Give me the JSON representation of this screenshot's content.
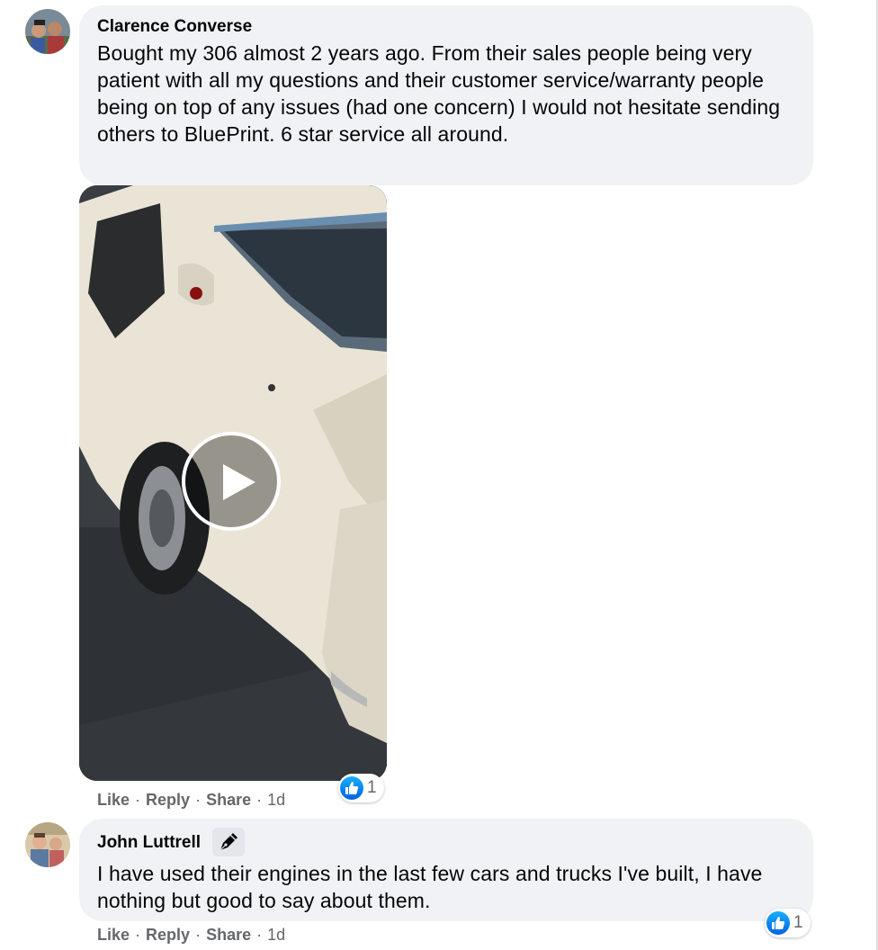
{
  "colors": {
    "bubble_bg": "#f0f2f5",
    "action_text": "#65676b",
    "like_blue": "#1877f2",
    "text": "#050505"
  },
  "comments": [
    {
      "author": "Clarence Converse",
      "text": "Bought my 306 almost 2 years ago. From their sales people being very patient with all my questions and their customer service/warranty people being on top of any issues (had one concern) I would not hesitate sending others to BluePrint. 6 star service all around.",
      "has_video": true,
      "actions": {
        "like": "Like",
        "reply": "Reply",
        "share": "Share",
        "sep": "·",
        "time": "1d"
      },
      "reaction_icon": "thumbs-up-icon",
      "reaction_count": "1"
    },
    {
      "author": "John Luttrell",
      "badge_icon": "pen-nib-icon",
      "text": "I have used their engines in the last few cars and trucks I've built, I have nothing but good to say about them.",
      "actions": {
        "like": "Like",
        "reply": "Reply",
        "share": "Share",
        "sep": "·",
        "time": "1d"
      },
      "reaction_icon": "thumbs-up-icon",
      "reaction_count": "1"
    }
  ]
}
